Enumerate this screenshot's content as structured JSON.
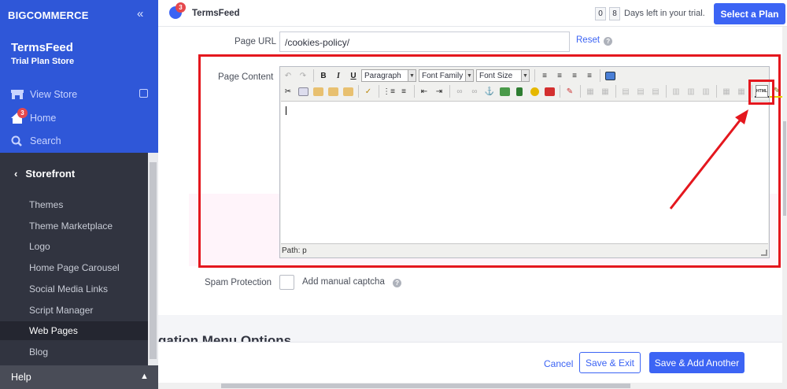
{
  "sidebar": {
    "logo": "BIGCOMMERCE",
    "store_name": "TermsFeed",
    "store_plan": "Trial Plan Store",
    "links": [
      {
        "label": "View Store",
        "icon": "storefront-icon"
      },
      {
        "label": "Home",
        "icon": "home-icon",
        "badge": "3"
      },
      {
        "label": "Search",
        "icon": "search-icon"
      }
    ],
    "section": "Storefront",
    "items": [
      "Themes",
      "Theme Marketplace",
      "Logo",
      "Home Page Carousel",
      "Social Media Links",
      "Script Manager",
      "Web Pages",
      "Blog"
    ],
    "active_item": "Web Pages",
    "help": "Help"
  },
  "topbar": {
    "notification_badge": "3",
    "store_name": "TermsFeed",
    "trial_digit_1": "0",
    "trial_digit_2": "8",
    "trial_text": "Days left in your trial.",
    "plan_button": "Select a Plan"
  },
  "form": {
    "page_url_label": "Page URL",
    "page_url_value": "/cookies-policy/",
    "reset_label": "Reset",
    "page_content_label": "Page Content",
    "spam_label": "Spam Protection",
    "spam_checkbox_label": "Add manual captcha"
  },
  "editor": {
    "format_select": "Paragraph",
    "font_family_select": "Font Family",
    "font_size_select": "Font Size",
    "bold": "B",
    "italic": "I",
    "underline": "U",
    "html_button": "HTML",
    "path_text": "Path: p"
  },
  "section_heading": "gation Menu Options",
  "footer": {
    "cancel": "Cancel",
    "save_exit": "Save & Exit",
    "save_add": "Save & Add Another"
  },
  "colors": {
    "accent": "#3c64f4",
    "highlight_red": "#e4171e",
    "sidebar_dark": "#313440"
  }
}
